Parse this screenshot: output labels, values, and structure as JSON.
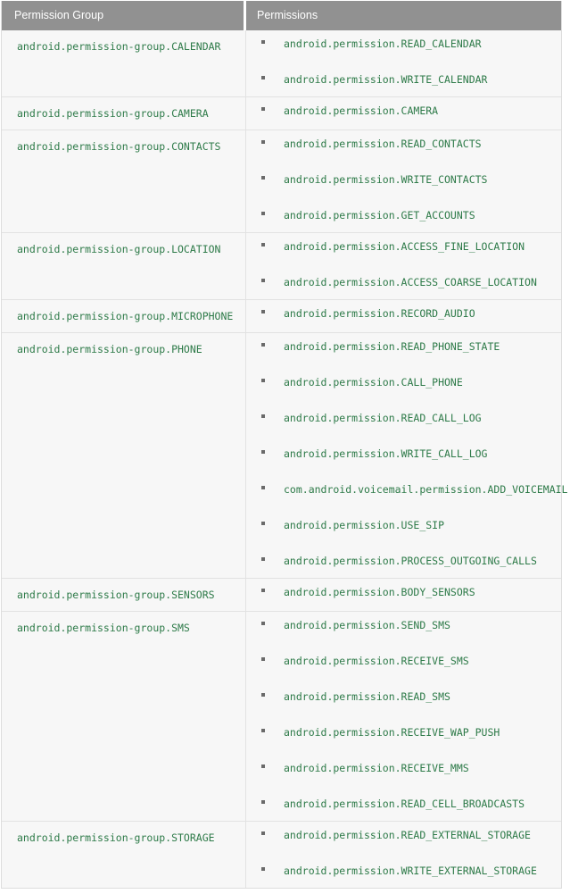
{
  "table": {
    "headers": {
      "group": "Permission Group",
      "permissions": "Permissions"
    },
    "bullet_icon": "bullet-square-icon",
    "colors": {
      "header_background": "#919191",
      "header_text": "#ffffff",
      "cell_background": "#f7f7f7",
      "cell_border": "#e2e2e2",
      "table_border": "#dddddd",
      "mono_text": "#2d7a48",
      "bullet": "#6a6a6a"
    },
    "rows": [
      {
        "group": "android.permission-group.CALENDAR",
        "permissions": [
          "android.permission.READ_CALENDAR",
          "android.permission.WRITE_CALENDAR"
        ]
      },
      {
        "group": "android.permission-group.CAMERA",
        "permissions": [
          "android.permission.CAMERA"
        ]
      },
      {
        "group": "android.permission-group.CONTACTS",
        "permissions": [
          "android.permission.READ_CONTACTS",
          "android.permission.WRITE_CONTACTS",
          "android.permission.GET_ACCOUNTS"
        ]
      },
      {
        "group": "android.permission-group.LOCATION",
        "permissions": [
          "android.permission.ACCESS_FINE_LOCATION",
          "android.permission.ACCESS_COARSE_LOCATION"
        ]
      },
      {
        "group": "android.permission-group.MICROPHONE",
        "permissions": [
          "android.permission.RECORD_AUDIO"
        ]
      },
      {
        "group": "android.permission-group.PHONE",
        "permissions": [
          "android.permission.READ_PHONE_STATE",
          "android.permission.CALL_PHONE",
          "android.permission.READ_CALL_LOG",
          "android.permission.WRITE_CALL_LOG",
          "com.android.voicemail.permission.ADD_VOICEMAIL",
          "android.permission.USE_SIP",
          "android.permission.PROCESS_OUTGOING_CALLS"
        ]
      },
      {
        "group": "android.permission-group.SENSORS",
        "permissions": [
          "android.permission.BODY_SENSORS"
        ]
      },
      {
        "group": "android.permission-group.SMS",
        "permissions": [
          "android.permission.SEND_SMS",
          "android.permission.RECEIVE_SMS",
          "android.permission.READ_SMS",
          "android.permission.RECEIVE_WAP_PUSH",
          "android.permission.RECEIVE_MMS",
          "android.permission.READ_CELL_BROADCASTS"
        ]
      },
      {
        "group": "android.permission-group.STORAGE",
        "permissions": [
          "android.permission.READ_EXTERNAL_STORAGE",
          "android.permission.WRITE_EXTERNAL_STORAGE"
        ]
      }
    ]
  }
}
